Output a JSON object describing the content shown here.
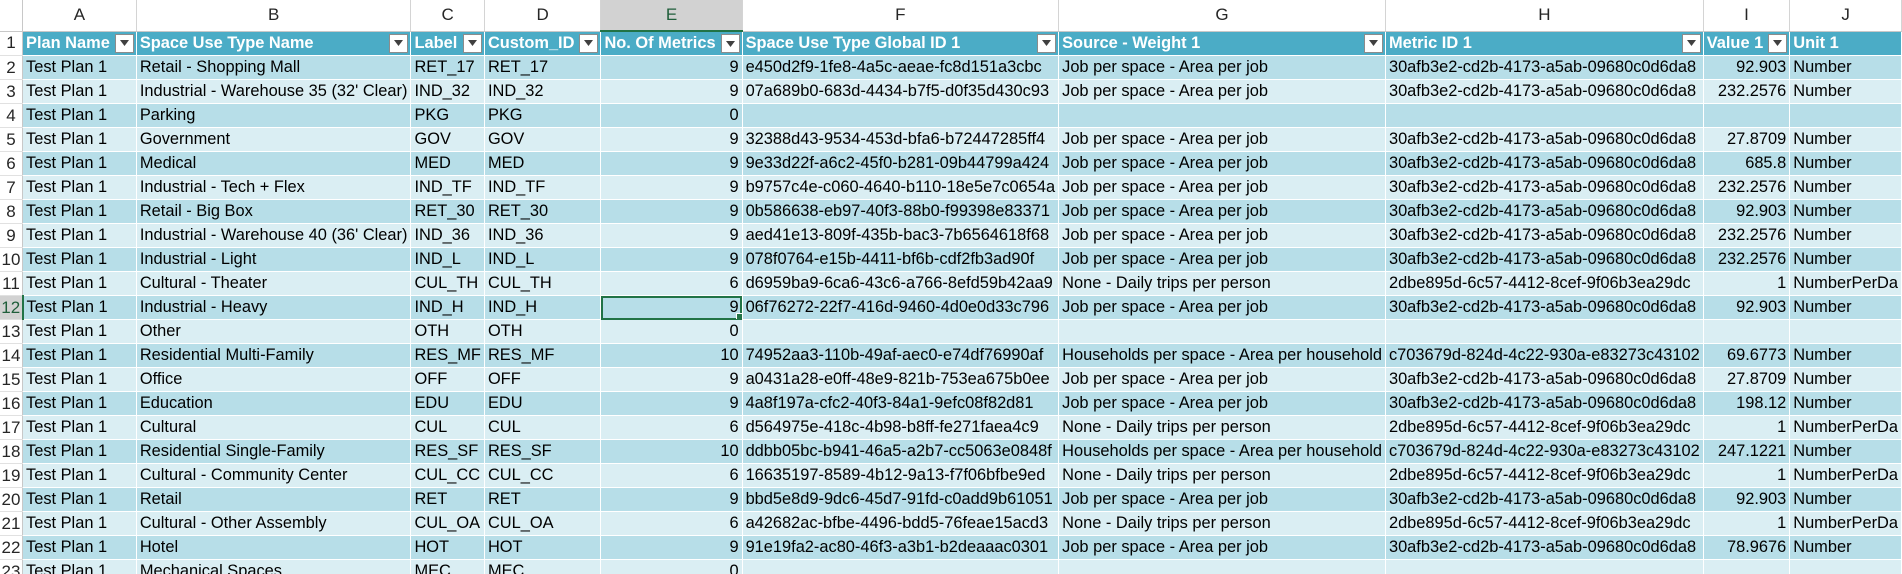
{
  "columns": [
    {
      "letter": "A",
      "header": "Plan Name",
      "align": "left"
    },
    {
      "letter": "B",
      "header": "Space Use Type Name",
      "align": "left"
    },
    {
      "letter": "C",
      "header": "Label",
      "align": "left"
    },
    {
      "letter": "D",
      "header": "Custom_ID",
      "align": "left"
    },
    {
      "letter": "E",
      "header": "No. Of Metrics",
      "align": "right"
    },
    {
      "letter": "F",
      "header": "Space Use Type Global ID 1",
      "align": "left"
    },
    {
      "letter": "G",
      "header": "Source - Weight 1",
      "align": "left"
    },
    {
      "letter": "H",
      "header": "Metric ID 1",
      "align": "left"
    },
    {
      "letter": "I",
      "header": "Value 1",
      "align": "right"
    },
    {
      "letter": "J",
      "header": "Unit 1",
      "align": "left"
    }
  ],
  "selected_column": "E",
  "selected_row": 12,
  "rows": [
    {
      "n": 2,
      "cells": [
        "Test Plan 1",
        "Retail - Shopping Mall",
        "RET_17",
        "RET_17",
        "9",
        "e450d2f9-1fe8-4a5c-aeae-fc8d151a3cbc",
        "Job per space - Area per job",
        "30afb3e2-cd2b-4173-a5ab-09680c0d6da8",
        "92.903",
        "Number"
      ]
    },
    {
      "n": 3,
      "cells": [
        "Test Plan 1",
        "Industrial - Warehouse 35 (32' Clear)",
        "IND_32",
        "IND_32",
        "9",
        "07a689b0-683d-4434-b7f5-d0f35d430c93",
        "Job per space - Area per job",
        "30afb3e2-cd2b-4173-a5ab-09680c0d6da8",
        "232.2576",
        "Number"
      ]
    },
    {
      "n": 4,
      "cells": [
        "Test Plan 1",
        "Parking",
        "PKG",
        "PKG",
        "0",
        "",
        "",
        "",
        "",
        ""
      ]
    },
    {
      "n": 5,
      "cells": [
        "Test Plan 1",
        "Government",
        "GOV",
        "GOV",
        "9",
        "32388d43-9534-453d-bfa6-b72447285ff4",
        "Job per space - Area per job",
        "30afb3e2-cd2b-4173-a5ab-09680c0d6da8",
        "27.8709",
        "Number"
      ]
    },
    {
      "n": 6,
      "cells": [
        "Test Plan 1",
        "Medical",
        "MED",
        "MED",
        "9",
        "9e33d22f-a6c2-45f0-b281-09b44799a424",
        "Job per space - Area per job",
        "30afb3e2-cd2b-4173-a5ab-09680c0d6da8",
        "685.8",
        "Number"
      ]
    },
    {
      "n": 7,
      "cells": [
        "Test Plan 1",
        "Industrial - Tech + Flex",
        "IND_TF",
        "IND_TF",
        "9",
        "b9757c4e-c060-4640-b110-18e5e7c0654a",
        "Job per space - Area per job",
        "30afb3e2-cd2b-4173-a5ab-09680c0d6da8",
        "232.2576",
        "Number"
      ]
    },
    {
      "n": 8,
      "cells": [
        "Test Plan 1",
        "Retail - Big Box",
        "RET_30",
        "RET_30",
        "9",
        "0b586638-eb97-40f3-88b0-f99398e83371",
        "Job per space - Area per job",
        "30afb3e2-cd2b-4173-a5ab-09680c0d6da8",
        "92.903",
        "Number"
      ]
    },
    {
      "n": 9,
      "cells": [
        "Test Plan 1",
        "Industrial - Warehouse 40 (36' Clear)",
        "IND_36",
        "IND_36",
        "9",
        "aed41e13-809f-435b-bac3-7b6564618f68",
        "Job per space - Area per job",
        "30afb3e2-cd2b-4173-a5ab-09680c0d6da8",
        "232.2576",
        "Number"
      ]
    },
    {
      "n": 10,
      "cells": [
        "Test Plan 1",
        "Industrial - Light",
        "IND_L",
        "IND_L",
        "9",
        "078f0764-e15b-4411-bf6b-cdf2fb3ad90f",
        "Job per space - Area per job",
        "30afb3e2-cd2b-4173-a5ab-09680c0d6da8",
        "232.2576",
        "Number"
      ]
    },
    {
      "n": 11,
      "cells": [
        "Test Plan 1",
        "Cultural - Theater",
        "CUL_TH",
        "CUL_TH",
        "6",
        "d6959ba9-6ca6-43c6-a766-8efd59b42aa9",
        "None - Daily trips per person",
        "2dbe895d-6c57-4412-8cef-9f06b3ea29dc",
        "1",
        "NumberPerDa"
      ]
    },
    {
      "n": 12,
      "cells": [
        "Test Plan 1",
        "Industrial - Heavy",
        "IND_H",
        "IND_H",
        "9",
        "06f76272-22f7-416d-9460-4d0e0d33c796",
        "Job per space - Area per job",
        "30afb3e2-cd2b-4173-a5ab-09680c0d6da8",
        "92.903",
        "Number"
      ]
    },
    {
      "n": 13,
      "cells": [
        "Test Plan 1",
        "Other",
        "OTH",
        "OTH",
        "0",
        "",
        "",
        "",
        "",
        ""
      ]
    },
    {
      "n": 14,
      "cells": [
        "Test Plan 1",
        "Residential Multi-Family",
        "RES_MF",
        "RES_MF",
        "10",
        "74952aa3-110b-49af-aec0-e74df76990af",
        "Households per space - Area per household",
        "c703679d-824d-4c22-930a-e83273c43102",
        "69.6773",
        "Number"
      ]
    },
    {
      "n": 15,
      "cells": [
        "Test Plan 1",
        "Office",
        "OFF",
        "OFF",
        "9",
        "a0431a28-e0ff-48e9-821b-753ea675b0ee",
        "Job per space - Area per job",
        "30afb3e2-cd2b-4173-a5ab-09680c0d6da8",
        "27.8709",
        "Number"
      ]
    },
    {
      "n": 16,
      "cells": [
        "Test Plan 1",
        "Education",
        "EDU",
        "EDU",
        "9",
        "4a8f197a-cfc2-40f3-84a1-9efc08f82d81",
        "Job per space - Area per job",
        "30afb3e2-cd2b-4173-a5ab-09680c0d6da8",
        "198.12",
        "Number"
      ]
    },
    {
      "n": 17,
      "cells": [
        "Test Plan 1",
        "Cultural",
        "CUL",
        "CUL",
        "6",
        "d564975e-418c-4b98-b8ff-fe271faea4c9",
        "None - Daily trips per person",
        "2dbe895d-6c57-4412-8cef-9f06b3ea29dc",
        "1",
        "NumberPerDa"
      ]
    },
    {
      "n": 18,
      "cells": [
        "Test Plan 1",
        "Residential Single-Family",
        "RES_SF",
        "RES_SF",
        "10",
        "ddbb05bc-b941-46a5-a2b7-cc5063e0848f",
        "Households per space - Area per household",
        "c703679d-824d-4c22-930a-e83273c43102",
        "247.1221",
        "Number"
      ]
    },
    {
      "n": 19,
      "cells": [
        "Test Plan 1",
        "Cultural - Community Center",
        "CUL_CC",
        "CUL_CC",
        "6",
        "16635197-8589-4b12-9a13-f7f06bfbe9ed",
        "None - Daily trips per person",
        "2dbe895d-6c57-4412-8cef-9f06b3ea29dc",
        "1",
        "NumberPerDa"
      ]
    },
    {
      "n": 20,
      "cells": [
        "Test Plan 1",
        "Retail",
        "RET",
        "RET",
        "9",
        "bbd5e8d9-9dc6-45d7-91fd-c0add9b61051",
        "Job per space - Area per job",
        "30afb3e2-cd2b-4173-a5ab-09680c0d6da8",
        "92.903",
        "Number"
      ]
    },
    {
      "n": 21,
      "cells": [
        "Test Plan 1",
        "Cultural - Other Assembly",
        "CUL_OA",
        "CUL_OA",
        "6",
        "a42682ac-bfbe-4496-bdd5-76feae15acd3",
        "None - Daily trips per person",
        "2dbe895d-6c57-4412-8cef-9f06b3ea29dc",
        "1",
        "NumberPerDa"
      ]
    },
    {
      "n": 22,
      "cells": [
        "Test Plan 1",
        "Hotel",
        "HOT",
        "HOT",
        "9",
        "91e19fa2-ac80-46f3-a3b1-b2deaaac0301",
        "Job per space - Area per job",
        "30afb3e2-cd2b-4173-a5ab-09680c0d6da8",
        "78.9676",
        "Number"
      ]
    },
    {
      "n": 23,
      "cells": [
        "Test Plan 1",
        "Mechanical Spaces",
        "MEC",
        "MEC",
        "0",
        "",
        "",
        "",
        "",
        ""
      ]
    }
  ]
}
